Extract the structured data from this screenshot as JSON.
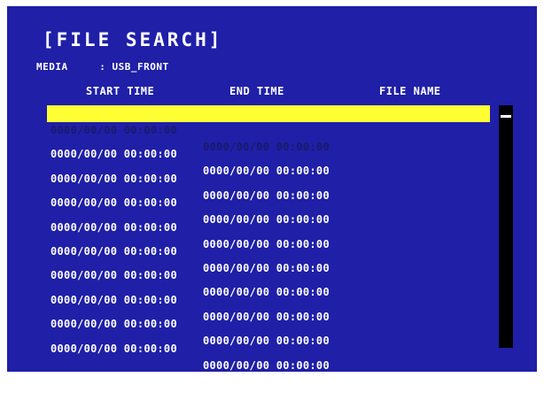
{
  "title": "[FILE SEARCH]",
  "media": {
    "label": "MEDIA",
    "separator": ":",
    "value": "USB_FRONT"
  },
  "columns": {
    "start_time": "START TIME",
    "end_time": "END TIME",
    "file_name": "FILE NAME"
  },
  "rows": [
    {
      "start": "0000/00/00 00:00:00",
      "end": "0000/00/00 00:00:00",
      "name": ""
    },
    {
      "start": "0000/00/00 00:00:00",
      "end": "0000/00/00 00:00:00",
      "name": ""
    },
    {
      "start": "0000/00/00 00:00:00",
      "end": "0000/00/00 00:00:00",
      "name": ""
    },
    {
      "start": "0000/00/00 00:00:00",
      "end": "0000/00/00 00:00:00",
      "name": ""
    },
    {
      "start": "0000/00/00 00:00:00",
      "end": "0000/00/00 00:00:00",
      "name": ""
    },
    {
      "start": "0000/00/00 00:00:00",
      "end": "0000/00/00 00:00:00",
      "name": ""
    },
    {
      "start": "0000/00/00 00:00:00",
      "end": "0000/00/00 00:00:00",
      "name": ""
    },
    {
      "start": "0000/00/00 00:00:00",
      "end": "0000/00/00 00:00:00",
      "name": ""
    },
    {
      "start": "0000/00/00 00:00:00",
      "end": "0000/00/00 00:00:00",
      "name": ""
    },
    {
      "start": "0000/00/00 00:00:00",
      "end": "0000/00/00 00:00:00",
      "name": ""
    }
  ],
  "selected_row": 0,
  "colors": {
    "background": "#1f1fa8",
    "highlight": "#ffff33",
    "text": "#ffffff"
  }
}
